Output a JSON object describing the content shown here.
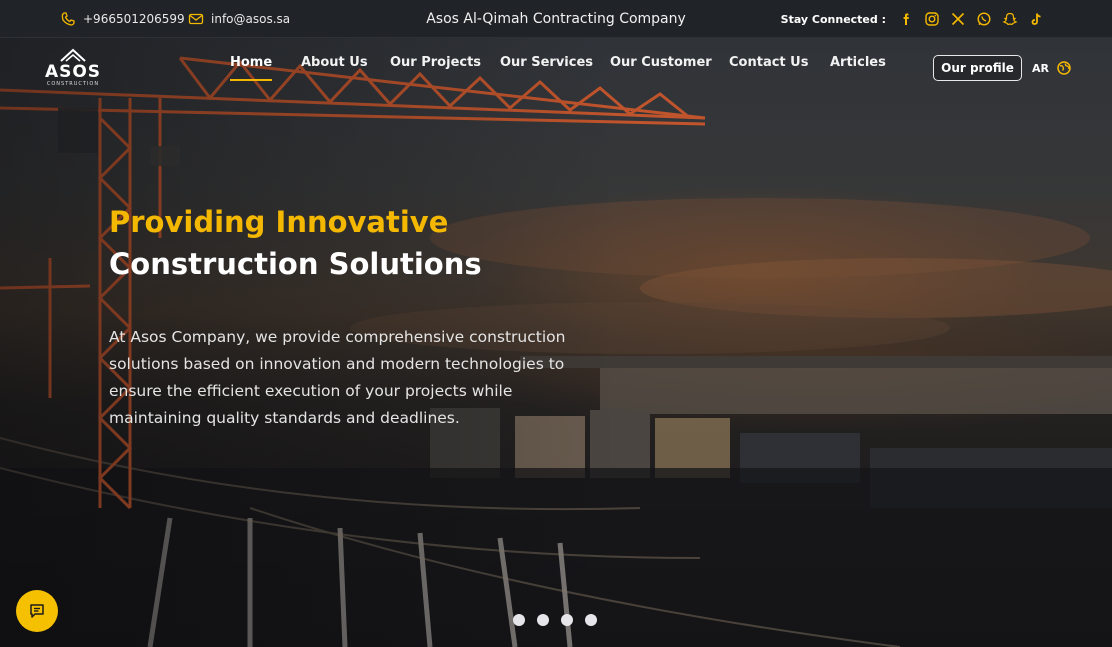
{
  "topbar": {
    "phone": "+966501206599",
    "email": "info@asos.sa",
    "company_name": "Asos Al-Qimah Contracting Company",
    "stay_connected": "Stay Connected :",
    "social_icons": [
      "facebook-icon",
      "instagram-icon",
      "x-icon",
      "whatsapp-icon",
      "snapchat-icon",
      "tiktok-icon"
    ]
  },
  "logo": {
    "text": "ASOS",
    "subtext": "CONSTRUCTION"
  },
  "nav": {
    "items": [
      {
        "label": "Home",
        "active": true
      },
      {
        "label": "About Us",
        "active": false
      },
      {
        "label": "Our Projects",
        "active": false
      },
      {
        "label": "Our Services",
        "active": false
      },
      {
        "label": "Our Customer",
        "active": false
      },
      {
        "label": "Contact Us",
        "active": false
      },
      {
        "label": "Articles",
        "active": false
      }
    ],
    "profile_button": "Our profile",
    "language": "AR"
  },
  "hero": {
    "headline_highlight": "Providing Innovative",
    "headline_main": "Construction Solutions",
    "description": "At Asos Company, we provide comprehensive construction solutions based on innovation and modern technologies to ensure the efficient execution of your projects while maintaining quality standards and deadlines.",
    "slides": [
      1,
      2,
      3,
      4
    ]
  },
  "colors": {
    "accent": "#f5b800",
    "topbar_bg": "#202327",
    "text_light": "#e4e4e4"
  }
}
